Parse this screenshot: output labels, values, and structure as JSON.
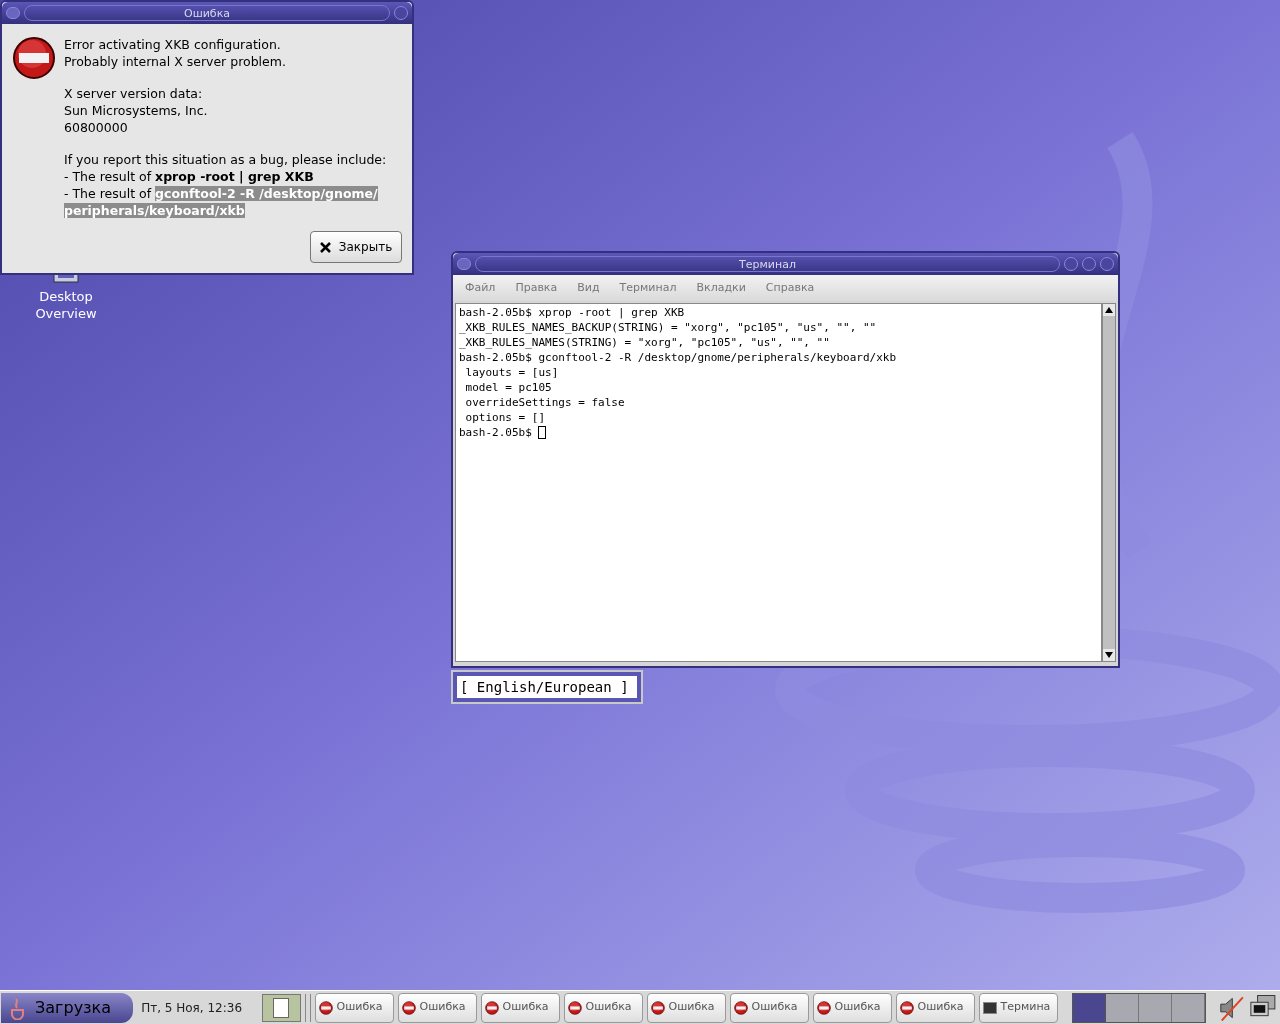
{
  "dialog": {
    "title": "Ошибка",
    "paragraphs": [
      [
        "Error activating XKB configuration.",
        "Probably internal X server problem."
      ],
      [
        "X server version data:",
        "Sun Microsystems, Inc.",
        "60800000"
      ],
      [
        "If you report this situation as a bug, please include:"
      ]
    ],
    "items": [
      {
        "text": "- The result of ",
        "command": "xprop -root | grep XKB",
        "selected": false
      },
      {
        "text": "- The result of ",
        "command": "gconftool-2 -R /desktop/gnome/peripherals/keyboard/xkb",
        "selected": true
      }
    ],
    "button": "Закрыть"
  },
  "desktop_icons": [
    {
      "label": "Desktop Overview"
    }
  ],
  "terminal": {
    "title": "Терминал",
    "menu": [
      "Файл",
      "Правка",
      "Вид",
      "Терминал",
      "Вкладки",
      "Справка"
    ],
    "lines": [
      "bash-2.05b$ xprop -root | grep XKB",
      "_XKB_RULES_NAMES_BACKUP(STRING) = \"xorg\", \"pc105\", \"us\", \"\", \"\"",
      "_XKB_RULES_NAMES(STRING) = \"xorg\", \"pc105\", \"us\", \"\", \"\"",
      "bash-2.05b$ gconftool-2 -R /desktop/gnome/peripherals/keyboard/xkb",
      " layouts = [us]",
      " model = pc105",
      " overrideSettings = false",
      " options = []"
    ],
    "prompt": "bash-2.05b$ "
  },
  "input_indicator": "[ English/European ]",
  "taskbar": {
    "start": "Загрузка",
    "clock": "Пт, 5 Ноя, 12:36",
    "tasks": [
      {
        "label": "Ошибка",
        "kind": "error"
      },
      {
        "label": "Ошибка",
        "kind": "error"
      },
      {
        "label": "Ошибка",
        "kind": "error"
      },
      {
        "label": "Ошибка",
        "kind": "error"
      },
      {
        "label": "Ошибка",
        "kind": "error"
      },
      {
        "label": "Ошибка",
        "kind": "error"
      },
      {
        "label": "Ошибка",
        "kind": "error"
      },
      {
        "label": "Ошибка",
        "kind": "error"
      },
      {
        "label": "Термина",
        "kind": "terminal"
      }
    ],
    "workspaces": [
      {
        "selected": true
      },
      {
        "selected": false
      },
      {
        "selected": false
      },
      {
        "selected": false
      }
    ]
  }
}
